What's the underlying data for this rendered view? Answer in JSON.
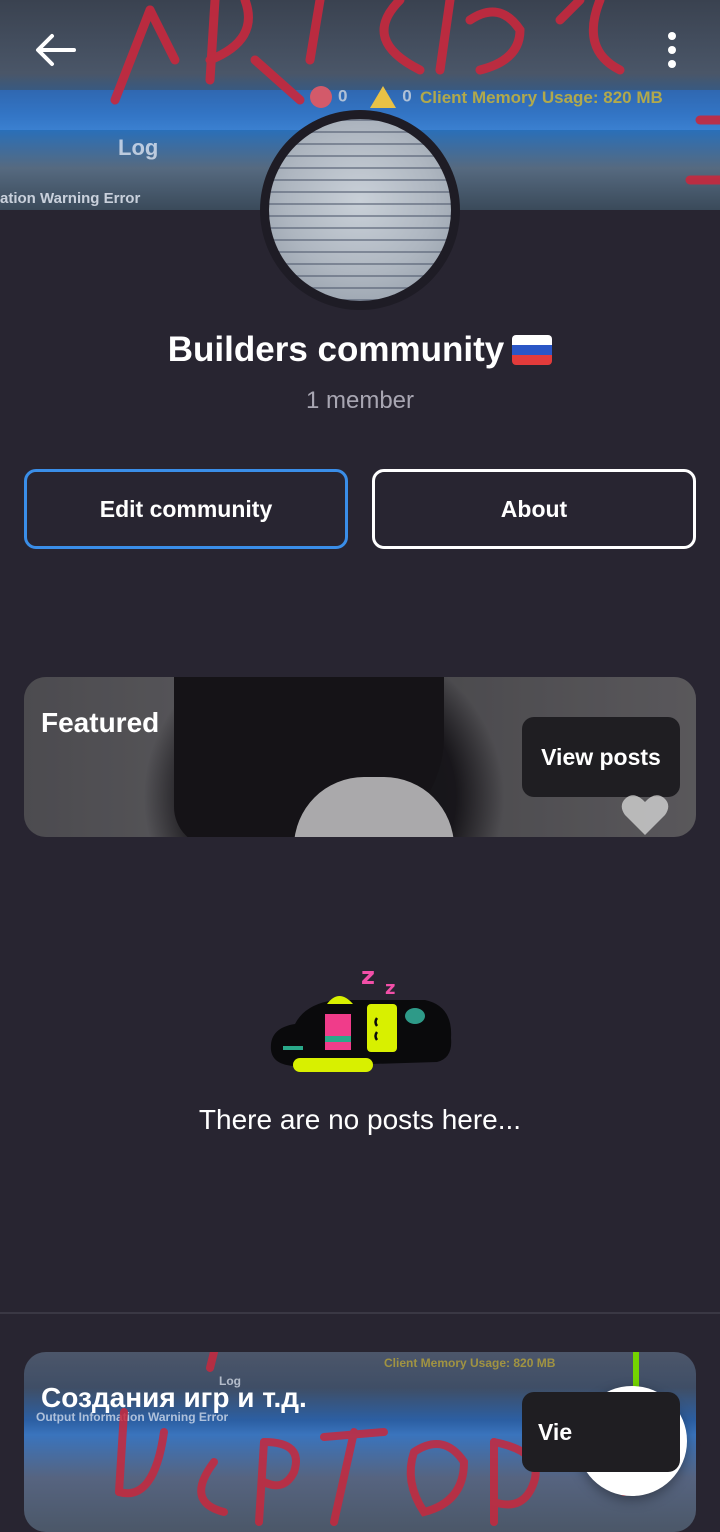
{
  "header": {
    "back_icon": "arrow-left-icon",
    "more_icon": "more-vertical-icon",
    "banner": {
      "log_label": "Log",
      "counter_a": "0",
      "counter_b": "0",
      "memory_label": "Client Memory Usage: 820 MB",
      "checks_label": "ation  Warning  Error"
    }
  },
  "community": {
    "name": "Builders community",
    "flag_icon": "russia-flag-icon",
    "members": "1 member"
  },
  "actions": {
    "edit_label": "Edit community",
    "about_label": "About"
  },
  "featured_card": {
    "label": "Featured",
    "view_label": "View posts",
    "heart_icon": "heart-icon"
  },
  "empty_state": {
    "icon": "sleeping-robot-icon",
    "text": "There are no posts here..."
  },
  "second_card": {
    "label": "Создания игр и т.д.",
    "view_label": "Vie",
    "mini_log": "Log",
    "mini_row": "Output  Information  Warning  Error",
    "mini_memory": "Client Memory Usage: 820 MB"
  },
  "fab": {
    "icon": "plus-icon"
  },
  "colors": {
    "background": "#282531",
    "edit_border": "#3a8ee8",
    "secondary_text": "#a8a6b2"
  }
}
